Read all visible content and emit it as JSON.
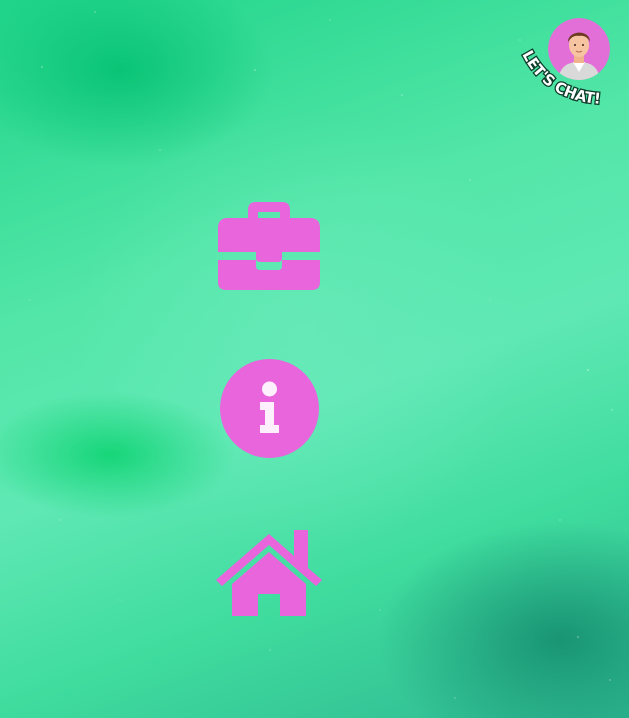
{
  "colors": {
    "icon_pink": "#e865dc",
    "background_green": "#4ee4a5",
    "avatar_bg": "#e26fd7"
  },
  "chat_widget": {
    "label": "LET'S CHAT!",
    "avatar_icon": "person-avatar"
  },
  "nav": {
    "items": [
      {
        "icon": "briefcase-icon"
      },
      {
        "icon": "info-icon"
      },
      {
        "icon": "home-icon"
      }
    ]
  }
}
